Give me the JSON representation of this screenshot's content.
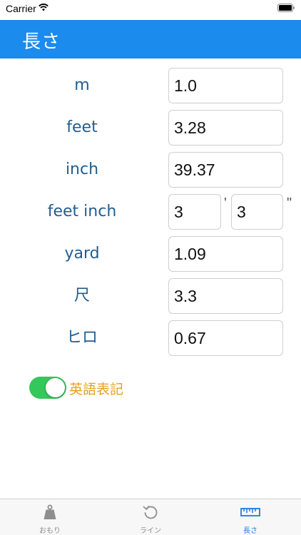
{
  "status_bar": {
    "carrier": "Carrier"
  },
  "header": {
    "title": "長さ"
  },
  "rows": [
    {
      "label": "m",
      "value": "1.0"
    },
    {
      "label": "feet",
      "value": "3.28"
    },
    {
      "label": "inch",
      "value": "39.37"
    },
    {
      "label": "feet inch",
      "feet_value": "3",
      "inch_value": "3",
      "feet_mark": "'",
      "inch_mark": "\""
    },
    {
      "label": "yard",
      "value": "1.09"
    },
    {
      "label": "尺",
      "value": "3.3"
    },
    {
      "label": "ヒロ",
      "value": "0.67"
    }
  ],
  "english_toggle": {
    "label": "英語表記",
    "on": true,
    "color": "#34c759"
  },
  "tabs": [
    {
      "label": "おもり",
      "icon": "weight-icon",
      "active": false
    },
    {
      "label": "ライン",
      "icon": "rotate-icon",
      "active": false
    },
    {
      "label": "長さ",
      "icon": "ruler-icon",
      "active": true
    }
  ],
  "colors": {
    "nav": "#1b8bee",
    "label": "#1f5e93",
    "toggle_label": "#e3a21a",
    "active_tab": "#1b7be0"
  }
}
